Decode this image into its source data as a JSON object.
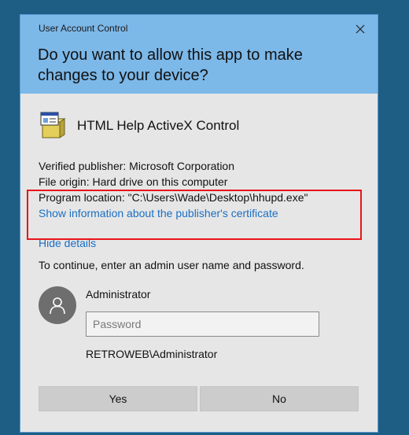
{
  "dialog": {
    "caption": "User Account Control",
    "question": "Do you want to allow this app to make changes to your device?"
  },
  "app": {
    "name": "HTML Help ActiveX Control",
    "icon": "application-window-icon"
  },
  "details": {
    "publisher": "Verified publisher: Microsoft Corporation",
    "origin": "File origin: Hard drive on this computer",
    "location": "Program location: \"C:\\Users\\Wade\\Desktop\\hhupd.exe\"",
    "certificate_link": "Show information about the publisher's certificate",
    "hide_details": "Hide details"
  },
  "credentials": {
    "prompt": "To continue, enter an admin user name and password.",
    "username": "Administrator",
    "password_placeholder": "Password",
    "password_value": "",
    "domain_user": "RETROWEB\\Administrator"
  },
  "buttons": {
    "yes": "Yes",
    "no": "No"
  },
  "colors": {
    "header": "#7cb8e8",
    "body": "#e6e6e6",
    "link": "#1a6fc4",
    "highlight": "#e8141a",
    "desktop": "#1f5e84"
  }
}
